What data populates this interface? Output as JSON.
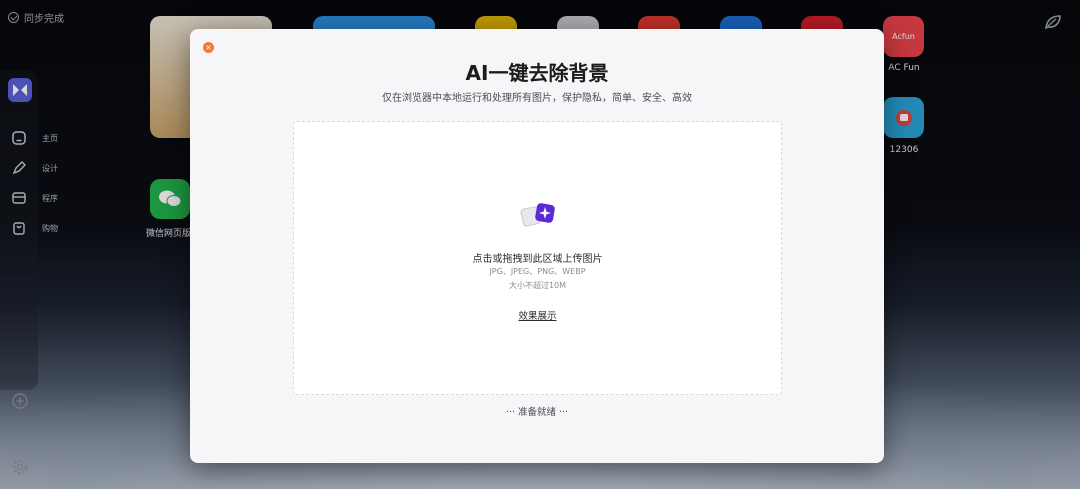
{
  "desktop": {
    "sync_status": "同步完成",
    "sidebar": {
      "items": [
        {
          "label": "主页",
          "icon": "home-icon"
        },
        {
          "label": "设计",
          "icon": "pen-icon"
        },
        {
          "label": "程序",
          "icon": "app-icon"
        },
        {
          "label": "购物",
          "icon": "bag-icon"
        }
      ]
    },
    "tiles": [
      {
        "label": "AC Fun",
        "badge": "Acfun"
      },
      {
        "label": "12306"
      },
      {
        "label": "微信网页版"
      }
    ]
  },
  "modal": {
    "title": "AI一键去除背景",
    "subtitle": "仅在浏览器中本地运行和处理所有图片，保护隐私，简单、安全、高效",
    "close_icon": "close-icon",
    "dropzone": {
      "main_text": "点击或拖拽到此区域上传图片",
      "formats": "JPG、JPEG、PNG、WEBP",
      "size_limit": "大小不超过10M",
      "demo_link": "效果展示"
    },
    "status": "··· 准备就绪 ···"
  },
  "colors": {
    "close": "#f0773e",
    "logo": "#5b5fd6",
    "upload_icon_purple": "#5b2ad6"
  }
}
